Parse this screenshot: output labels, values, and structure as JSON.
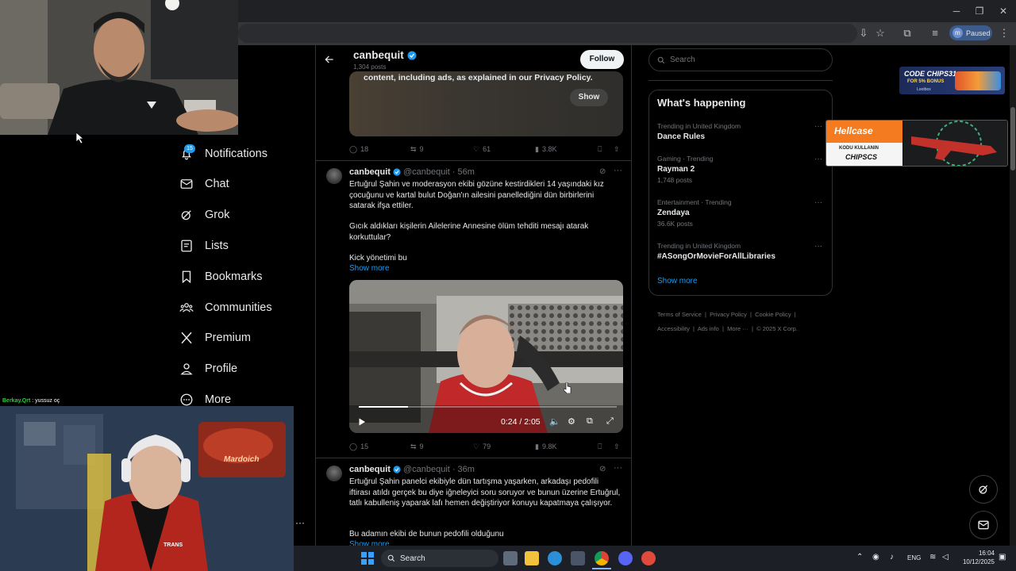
{
  "browser": {
    "profile_initial": "m",
    "profile_status": "Paused"
  },
  "nav": {
    "notif_count": "15",
    "items": [
      {
        "label": "Notifications"
      },
      {
        "label": "Chat"
      },
      {
        "label": "Grok"
      },
      {
        "label": "Lists"
      },
      {
        "label": "Bookmarks"
      },
      {
        "label": "Communities"
      },
      {
        "label": "Premium"
      },
      {
        "label": "Profile"
      },
      {
        "label": "More"
      }
    ]
  },
  "profile_header": {
    "name": "canbequit",
    "posts": "1,304 posts",
    "follow_label": "Follow"
  },
  "tweet0": {
    "media_notice": "content, including ads, as explained in our Privacy Policy.",
    "show_label": "Show",
    "replies": "18",
    "reposts": "9",
    "likes": "61",
    "views": "3.8K"
  },
  "tweet1": {
    "name": "canbequit",
    "handle": "@canbequit",
    "time": "· 56m",
    "p1": "Ertuğrul Şahin ve moderasyon ekibi gözüne kestirdikleri 14 yaşındaki kız çocuğunu ve kartal bulut Doğan'ın ailesini panellediğini dün birbirlerini satarak ifşa ettiler.",
    "p2": "Gıcık aldıkları kişilerin Ailelerine Annesine ölüm tehditi mesajı atarak korkuttular?",
    "p3": "Kick yönetimi bu",
    "show_more": "Show more",
    "video_time": "0:24 / 2:05",
    "replies": "15",
    "reposts": "9",
    "likes": "79",
    "views": "9.8K"
  },
  "tweet2": {
    "name": "canbequit",
    "handle": "@canbequit",
    "time": "· 36m",
    "p1": "Ertuğrul Şahin panelci ekibiyle dün tartışma yaşarken, arkadaşı pedofili iftirası atıldı gerçek bu diye iğneleyici soru soruyor ve bunun üzerine Ertuğrul, tatlı kabulleniş yaparak lafı hemen değiştiriyor konuyu kapatmaya çalışıyor.",
    "p2": "Bu adamın ekibi de bunun pedofili olduğunu",
    "show_more": "Show more"
  },
  "search": {
    "placeholder": "Search"
  },
  "trends": {
    "title": "What's happening",
    "items": [
      {
        "context": "Trending in United Kingdom",
        "title": "Dance Rules",
        "count": ""
      },
      {
        "context": "Gaming · Trending",
        "title": "Rayman 2",
        "count": "1,748 posts"
      },
      {
        "context": "Entertainment · Trending",
        "title": "Zendaya",
        "count": "36.6K posts"
      },
      {
        "context": "Trending in United Kingdom",
        "title": "#ASongOrMovieForAllLibraries",
        "count": ""
      }
    ],
    "show_more": "Show more"
  },
  "footer": {
    "links": [
      "Terms of Service",
      "Privacy Policy",
      "Cookie Policy",
      "Accessibility",
      "Ads info",
      "More ···",
      "© 2025 X Corp."
    ]
  },
  "ads": {
    "chips_code": "CODE CHIPS31",
    "chips_bonus": "FOR 5% BONUS",
    "chips_brand": "Lootbox",
    "hellcase_brand": "Hellcase",
    "hellcase_line1": "KODU KULLANIN",
    "hellcase_code": "CHIPSCS"
  },
  "stream": {
    "chat_line_user": "Berkay.Qrt",
    "chat_line_text": ": yussuz oç",
    "cam2_sign": "Mardoich",
    "shirt_text": "TRANS"
  },
  "taskbar": {
    "search": "Search",
    "lang": "ENG",
    "time": "16:04",
    "date": "10/12/2025"
  },
  "colors": {
    "accent": "#1d9bf0",
    "chrome_toolbar": "#35363a"
  }
}
